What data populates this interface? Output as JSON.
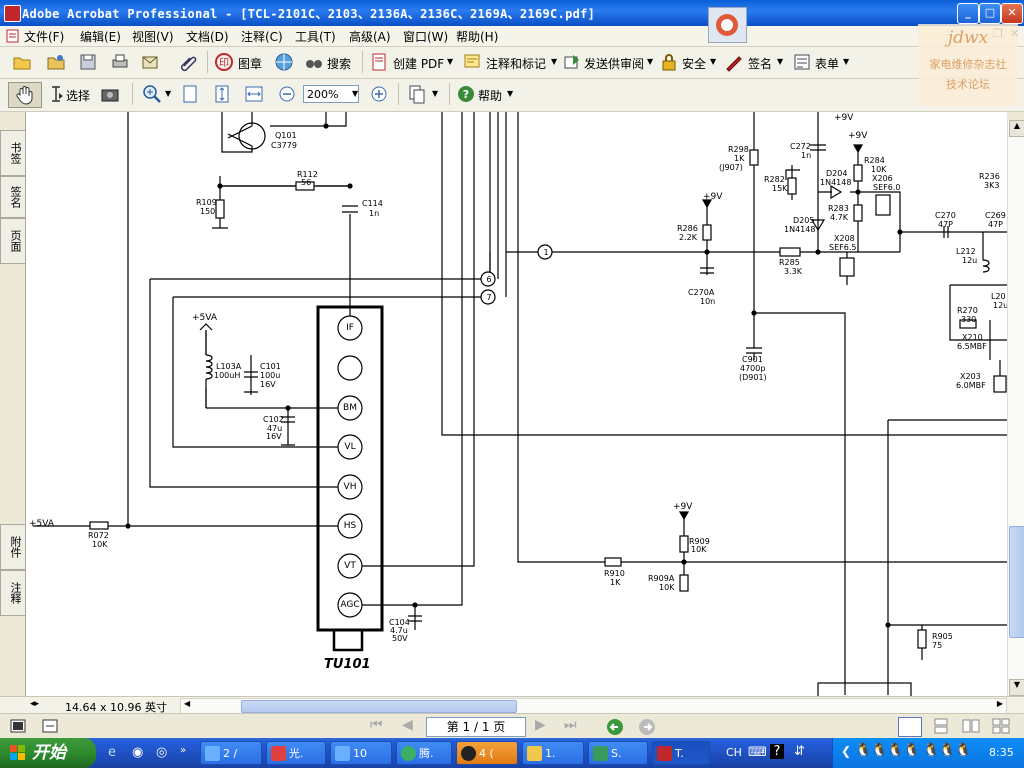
{
  "window": {
    "title": "Adobe Acrobat Professional - [TCL-2101C、2103、2136A、2136C、2169A、2169C.pdf]"
  },
  "menu": [
    "文件(F)",
    "编辑(E)",
    "视图(V)",
    "文档(D)",
    "注释(C)",
    "工具(T)",
    "高级(A)",
    "窗口(W)",
    "帮助(H)"
  ],
  "toolbar1": {
    "stamp": "图章",
    "search": "搜索",
    "create_pdf": "创建 PDF",
    "comment_markup": "注释和标记",
    "send_review": "发送供审阅",
    "security": "安全",
    "sign": "签名",
    "forms": "表单"
  },
  "toolbar2": {
    "select": "选择",
    "zoom": "200%",
    "help": "帮助"
  },
  "watermark": {
    "brand": "jdwx",
    "line1": "家电维修杂志社",
    "line2": "技术论坛"
  },
  "nav_tabs": [
    "书签",
    "签名",
    "页面",
    "附件",
    "注释"
  ],
  "schematic": {
    "tuner_name": "TU101",
    "tuner_pins": [
      "IF",
      "",
      "BM",
      "VL",
      "VH",
      "HS",
      "VT",
      "AGC"
    ],
    "labels": {
      "q101": "Q101",
      "q101_part": "C3779",
      "r109": "R109",
      "r109_v": "150",
      "r112": "R112",
      "r112_v": "56",
      "c114": "C114",
      "c114_v": "1n",
      "p5va_top": "+5VA",
      "l103a": "L103A",
      "l103a_v": "100uH",
      "c101": "C101",
      "c101_v": "100u",
      "c101_v2": "16V",
      "c102": "C102",
      "c102_v": "47u",
      "c102_v2": "16V",
      "p5va_left": "+5VA",
      "r072": "R072",
      "r072_v": "10K",
      "c104": "C104",
      "c104_v": "4.7u",
      "c104_v2": "50V",
      "conn6": "6",
      "conn7": "7",
      "conn1": "1",
      "r298": "R298",
      "r298_v": "1K",
      "r298_v2": "(J907)",
      "c272": "C272",
      "c272_v": "1n",
      "p9v_a": "+9V",
      "p9v_b": "+9V",
      "p9v_c": "+9V",
      "p9v_d": "+9V",
      "r284": "R284",
      "r284_v": "10K",
      "x206": "X206",
      "x206_v": "SEF6.0",
      "d204": "D204",
      "d204_v": "1N4148",
      "r282": "R282",
      "r282_v": "15K",
      "r283": "R283",
      "r283_v": "4.7K",
      "d205": "D205",
      "d205_v": "1N4148",
      "r286": "R286",
      "r286_v": "2.2K",
      "x208": "X208",
      "x208_v": "SEF6.5",
      "r285": "R285",
      "r285_v": "3.3K",
      "c270a": "C270A",
      "c270a_v": "10n",
      "c901": "C901",
      "c901_v": "4700p",
      "c901_v2": "(D901)",
      "r236": "R236",
      "r236_v": "3K3",
      "c270": "C270",
      "c270_v": "47P",
      "c269": "C269",
      "c269_v": "47P",
      "l212": "L212",
      "l212_v": "12u",
      "r270": "R270",
      "r270_v": "330",
      "l20x": "L20",
      "l20x_v": "12u",
      "x210": "X210",
      "x210_v": "6.5MBF",
      "x203": "X203",
      "x203_v": "6.0MBF",
      "r909": "R909",
      "r909_v": "10K",
      "r910": "R910",
      "r910_v": "1K",
      "r909a": "R909A",
      "r909a_v": "10K",
      "r905": "R905",
      "r905_v": "75"
    }
  },
  "status": {
    "page_size": "14.64 x 10.96 英寸",
    "page_indicator": "第 1 / 1 页"
  },
  "taskbar": {
    "start": "开始",
    "buttons": [
      "2 /",
      "光.",
      "10",
      "腾.",
      "4 (",
      "1.",
      "S.",
      "T."
    ],
    "ime": "CH",
    "time": "8:35"
  }
}
